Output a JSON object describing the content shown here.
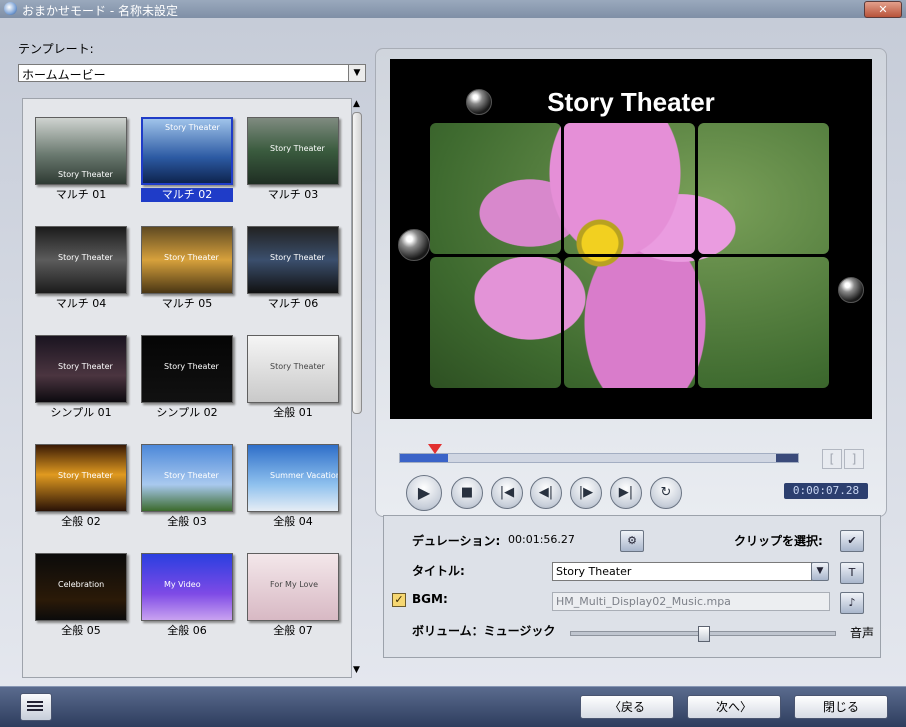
{
  "window": {
    "title": "おまかせモード - 名称未設定",
    "close_label": "✕"
  },
  "template": {
    "label": "テンプレート:",
    "selected": "ホームムービー",
    "items": [
      {
        "label": "マルチ 01",
        "thumb_text": "Story Theater"
      },
      {
        "label": "マルチ 02",
        "thumb_text": "Story Theater"
      },
      {
        "label": "マルチ 03",
        "thumb_text": "Story Theater"
      },
      {
        "label": "マルチ 04",
        "thumb_text": "Story Theater"
      },
      {
        "label": "マルチ 05",
        "thumb_text": "Story Theater"
      },
      {
        "label": "マルチ 06",
        "thumb_text": "Story Theater"
      },
      {
        "label": "シンプル 01",
        "thumb_text": "Story Theater"
      },
      {
        "label": "シンプル 02",
        "thumb_text": "Story Theater"
      },
      {
        "label": "全般 01",
        "thumb_text": "Story Theater"
      },
      {
        "label": "全般 02",
        "thumb_text": "Story Theater"
      },
      {
        "label": "全般 03",
        "thumb_text": "Story Theater"
      },
      {
        "label": "全般 04",
        "thumb_text": "Summer Vacation"
      },
      {
        "label": "全般 05",
        "thumb_text": "Celebration"
      },
      {
        "label": "全般 06",
        "thumb_text": "My Video"
      },
      {
        "label": "全般 07",
        "thumb_text": "For My Love"
      }
    ],
    "selected_index": 1
  },
  "preview": {
    "title_overlay": "Story Theater",
    "timecode": "0:00:07.28",
    "progress": 0.12,
    "mark_in": "[",
    "mark_out": "]"
  },
  "controls": {
    "play": "play-icon",
    "stop": "stop-icon",
    "prev": "skip-start-icon",
    "step_back": "step-back-icon",
    "step_forward": "step-forward-icon",
    "next": "skip-end-icon",
    "repeat": "repeat-icon"
  },
  "settings": {
    "duration_label": "デュレーション:",
    "duration_value": "00:01:56.27",
    "clip_label": "クリップを選択:",
    "title_label": "タイトル:",
    "title_value": "Story Theater",
    "bgm_label": "BGM:",
    "bgm_checked": true,
    "bgm_value": "HM_Multi_Display02_Music.mpa",
    "volume_label": "ボリューム：ミュージック",
    "volume_right": "音声",
    "volume_level": 0.5
  },
  "footer": {
    "back": "〈戻る",
    "next": "次へ〉",
    "close": "閉じる"
  }
}
